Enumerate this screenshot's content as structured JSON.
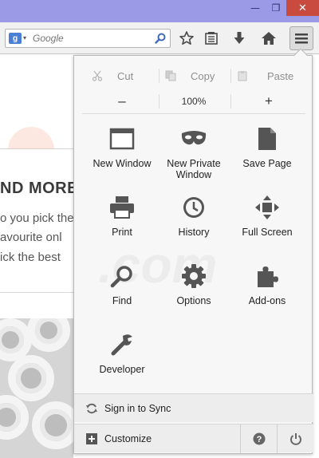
{
  "window": {
    "minimize_glyph": "—",
    "maximize_glyph": "❐",
    "close_glyph": "✕"
  },
  "toolbar": {
    "search_engine_badge": "g",
    "search_placeholder": "Google",
    "icons": [
      "bookmark-star-icon",
      "reading-list-icon",
      "download-icon",
      "home-icon",
      "menu-icon"
    ]
  },
  "page": {
    "heading": "ND MORE I",
    "lines": [
      "o you pick the",
      "avourite onl",
      "ick the best"
    ]
  },
  "menu": {
    "edit": {
      "cut_label": "Cut",
      "copy_label": "Copy",
      "paste_label": "Paste"
    },
    "zoom": {
      "minus_label": "–",
      "value": "100%",
      "plus_label": "+"
    },
    "items": [
      {
        "label": "New Window",
        "icon": "new-window-icon"
      },
      {
        "label": "New Private\nWindow",
        "icon": "private-mask-icon"
      },
      {
        "label": "Save Page",
        "icon": "save-page-icon"
      },
      {
        "label": "Print",
        "icon": "printer-icon"
      },
      {
        "label": "History",
        "icon": "history-clock-icon"
      },
      {
        "label": "Full Screen",
        "icon": "full-screen-icon"
      },
      {
        "label": "Find",
        "icon": "magnifier-icon"
      },
      {
        "label": "Options",
        "icon": "gear-icon"
      },
      {
        "label": "Add-ons",
        "icon": "puzzle-piece-icon"
      },
      {
        "label": "Developer",
        "icon": "wrench-icon"
      }
    ],
    "sync_label": "Sign in to Sync",
    "customize_label": "Customize"
  },
  "colors": {
    "titlebar": "#9b9ae6",
    "close_button": "#c94a3f",
    "icon_dark": "#5a5a5a",
    "google_badge": "#4b7fd6"
  }
}
